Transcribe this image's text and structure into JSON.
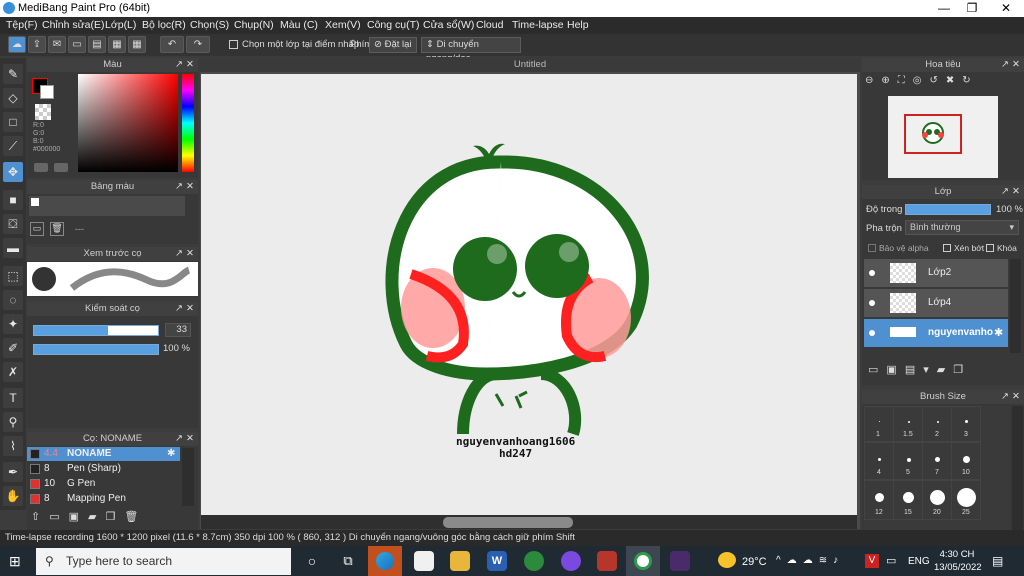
{
  "titlebar": {
    "title": "MediBang Paint Pro (64bit)"
  },
  "menu": [
    "Tệp(F)",
    "Chỉnh sửa(E)",
    "Lớp(L)",
    "Bộ lọc(R)",
    "Chọn(S)",
    "Chụp(N)",
    "Màu (C)",
    "Xem(V)",
    "Công cụ(T)",
    "Cửa sổ(W)",
    "Cloud",
    "Time-lapse",
    "Help"
  ],
  "toolbar": {
    "select_layer_label": "Chọn một lớp tại điểm nhấp",
    "phim_label": "Phím",
    "reset_label": "Đặt lại",
    "move_label": "Di chuyển ngang/dọc"
  },
  "color_panel": {
    "title": "Màu",
    "r": "R:0",
    "g": "G:0",
    "b": "B:0",
    "hex": "#000000"
  },
  "palette_panel": {
    "title": "Bảng màu",
    "dash": "---"
  },
  "brush_preview_panel": {
    "title": "Xem trước cọ"
  },
  "brush_control_panel": {
    "title": "Kiểm soát cọ",
    "size": "33",
    "opacity": "100 %"
  },
  "brush_panel": {
    "title": "Cọ: NONAME",
    "items": [
      {
        "size": "4.4",
        "name": "NONAME",
        "color": "#222222"
      },
      {
        "size": "8",
        "name": "Pen (Sharp)",
        "color": "#222222"
      },
      {
        "size": "10",
        "name": "G Pen",
        "color": "#e03030"
      },
      {
        "size": "8",
        "name": "Mapping Pen",
        "color": "#e03030"
      }
    ]
  },
  "document": {
    "tab": "Untitled",
    "signature_line1": "nguyenvanhoang1606",
    "signature_line2": "hd247"
  },
  "navigator": {
    "title": "Hoa tiêu"
  },
  "layers_panel": {
    "title": "Lớp",
    "opacity_label": "Độ trong",
    "opacity_value": "100 %",
    "blend_label": "Pha trộn",
    "blend_value": "Bình thường",
    "protect_alpha": "Bảo vệ alpha",
    "clip": "Xén bớt",
    "lock": "Khóa",
    "layers": [
      "Lớp2",
      "Lớp4",
      "nguyenvanho"
    ]
  },
  "brush_size_panel": {
    "title": "Brush Size",
    "sizes": [
      "1",
      "1.5",
      "2",
      "3",
      "4",
      "5",
      "7",
      "10",
      "12",
      "15",
      "20",
      "25"
    ]
  },
  "status": {
    "text": "Time-lapse recording  1600 * 1200 pixel  (11.6 * 8.7cm)  350 dpi  100 %  ( 860, 312 )  Di chuyển ngang/vuông góc bằng cách giữ phím Shift"
  },
  "taskbar": {
    "search_placeholder": "Type here to search",
    "weather": "29°C",
    "lang": "ENG",
    "time": "4:30 CH",
    "date": "13/05/2022"
  },
  "colors": {
    "accent": "#4f90d0",
    "character_green": "#1e6b1e",
    "blush": "#ff3030"
  }
}
